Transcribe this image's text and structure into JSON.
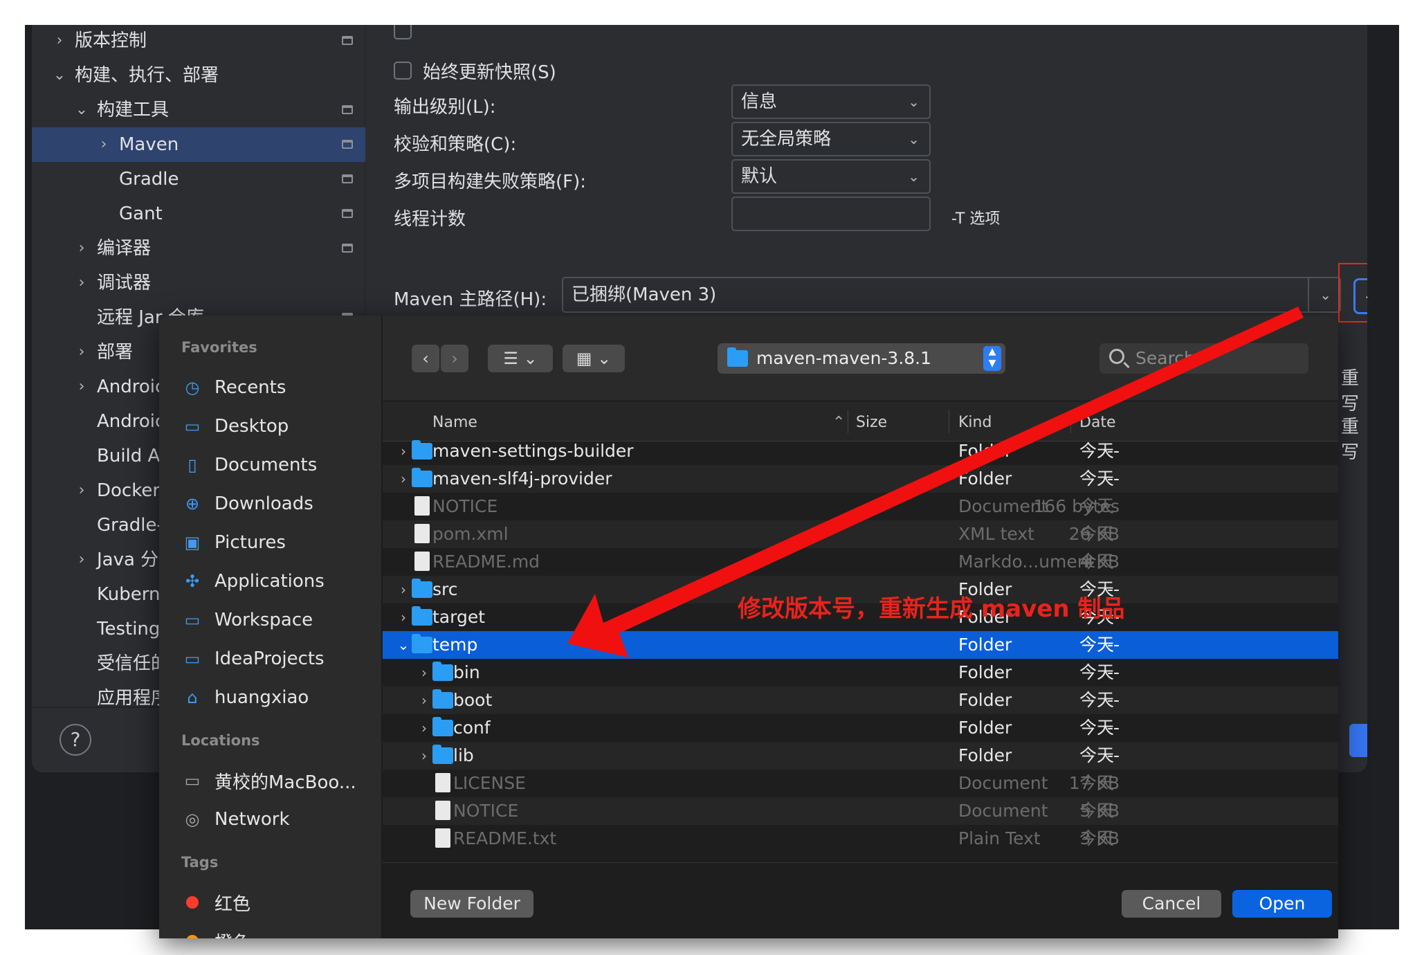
{
  "settings": {
    "tree": [
      {
        "label": "版本控制",
        "chevron": "›",
        "indent": 0,
        "page_icon": true,
        "selected": false
      },
      {
        "label": "构建、执行、部署",
        "chevron": "⌄",
        "indent": 0,
        "page_icon": false,
        "selected": false
      },
      {
        "label": "构建工具",
        "chevron": "⌄",
        "indent": 1,
        "page_icon": true,
        "selected": false
      },
      {
        "label": "Maven",
        "chevron": "›",
        "indent": 2,
        "page_icon": true,
        "selected": true
      },
      {
        "label": "Gradle",
        "chevron": "",
        "indent": 2,
        "page_icon": true,
        "selected": false
      },
      {
        "label": "Gant",
        "chevron": "",
        "indent": 2,
        "page_icon": true,
        "selected": false
      },
      {
        "label": "编译器",
        "chevron": "›",
        "indent": 1,
        "page_icon": true,
        "selected": false
      },
      {
        "label": "调试器",
        "chevron": "›",
        "indent": 1,
        "page_icon": false,
        "selected": false
      },
      {
        "label": "远程 Jar 仓库",
        "chevron": "",
        "indent": 1,
        "page_icon": true,
        "selected": false
      },
      {
        "label": "部署",
        "chevron": "›",
        "indent": 1,
        "page_icon": false,
        "selected": false
      },
      {
        "label": "Androic",
        "chevron": "›",
        "indent": 1,
        "page_icon": false,
        "selected": false
      },
      {
        "label": "Androic",
        "chevron": "",
        "indent": 1,
        "page_icon": false,
        "selected": false
      },
      {
        "label": "Build A",
        "chevron": "",
        "indent": 1,
        "page_icon": false,
        "selected": false
      },
      {
        "label": "Docker",
        "chevron": "›",
        "indent": 1,
        "page_icon": false,
        "selected": false
      },
      {
        "label": "Gradle-",
        "chevron": "",
        "indent": 1,
        "page_icon": false,
        "selected": false
      },
      {
        "label": "Java 分",
        "chevron": "›",
        "indent": 1,
        "page_icon": false,
        "selected": false
      },
      {
        "label": "Kubern",
        "chevron": "",
        "indent": 1,
        "page_icon": false,
        "selected": false
      },
      {
        "label": "Testing",
        "chevron": "",
        "indent": 1,
        "page_icon": false,
        "selected": false
      },
      {
        "label": "受信任的",
        "chevron": "",
        "indent": 1,
        "page_icon": false,
        "selected": false
      },
      {
        "label": "应用程序",
        "chevron": "",
        "indent": 1,
        "page_icon": false,
        "selected": false
      }
    ],
    "help_label": "?",
    "checkbox_always_update": "始终更新快照(S)",
    "output_level_label": "输出级别(L):",
    "output_level_value": "信息",
    "checksum_label": "校验和策略(C):",
    "checksum_value": "无全局策略",
    "multiproject_label": "多项目构建失败策略(F):",
    "multiproject_value": "默认",
    "threads_label": "线程计数",
    "threads_value": "",
    "threads_hint": "-T 选项",
    "maven_home_label": "Maven 主路径(H):",
    "maven_home_value": "已捆绑(Maven 3)",
    "browse_label": "...",
    "side_partial_1": "重写",
    "side_partial_2": "重写"
  },
  "dialog": {
    "sidebar": {
      "favorites_heading": "Favorites",
      "favorites": [
        {
          "label": "Recents",
          "icon": "clock-icon"
        },
        {
          "label": "Desktop",
          "icon": "desktop-icon"
        },
        {
          "label": "Documents",
          "icon": "document-icon"
        },
        {
          "label": "Downloads",
          "icon": "download-icon"
        },
        {
          "label": "Pictures",
          "icon": "pictures-icon"
        },
        {
          "label": "Applications",
          "icon": "applications-icon"
        },
        {
          "label": "Workspace",
          "icon": "folder-icon"
        },
        {
          "label": "IdeaProjects",
          "icon": "folder-icon"
        },
        {
          "label": "huangxiao",
          "icon": "home-icon"
        }
      ],
      "locations_heading": "Locations",
      "locations": [
        {
          "label": "黄校的MacBoo...",
          "icon": "laptop-icon"
        },
        {
          "label": "Network",
          "icon": "network-icon"
        }
      ],
      "tags_heading": "Tags",
      "tags": [
        {
          "label": "红色",
          "color": "#ff3b30"
        },
        {
          "label": "橙色",
          "color": "#ff9500"
        }
      ]
    },
    "toolbar": {
      "back": "‹",
      "forward": "›",
      "list_view": "☰ ⌄",
      "grid_view": "▦ ⌄",
      "path": "maven-maven-3.8.1",
      "search_placeholder": "Search"
    },
    "columns": {
      "name": "Name",
      "size": "Size",
      "kind": "Kind",
      "date": "Date"
    },
    "files": [
      {
        "name": "maven-settings-builder",
        "size": "--",
        "kind": "Folder",
        "date": "今天",
        "type": "folder",
        "level": 0,
        "expand": "›",
        "dim": false,
        "selected": false
      },
      {
        "name": "maven-slf4j-provider",
        "size": "--",
        "kind": "Folder",
        "date": "今天",
        "type": "folder",
        "level": 0,
        "expand": "›",
        "dim": false,
        "selected": false
      },
      {
        "name": "NOTICE",
        "size": "166 bytes",
        "kind": "Document",
        "date": "今天",
        "type": "doc",
        "level": 0,
        "expand": "",
        "dim": true,
        "selected": false
      },
      {
        "name": "pom.xml",
        "size": "26 KB",
        "kind": "XML text",
        "date": "今天",
        "type": "doc",
        "level": 0,
        "expand": "",
        "dim": true,
        "selected": false
      },
      {
        "name": "README.md",
        "size": "4 KB",
        "kind": "Markdo...ument",
        "date": "今天",
        "type": "doc",
        "level": 0,
        "expand": "",
        "dim": true,
        "selected": false
      },
      {
        "name": "src",
        "size": "--",
        "kind": "Folder",
        "date": "今天",
        "type": "folder",
        "level": 0,
        "expand": "›",
        "dim": false,
        "selected": false
      },
      {
        "name": "target",
        "size": "--",
        "kind": "Folder",
        "date": "今天",
        "type": "folder",
        "level": 0,
        "expand": "›",
        "dim": false,
        "selected": false
      },
      {
        "name": "temp",
        "size": "--",
        "kind": "Folder",
        "date": "今天",
        "type": "folder",
        "level": 0,
        "expand": "⌄",
        "dim": false,
        "selected": true
      },
      {
        "name": "bin",
        "size": "--",
        "kind": "Folder",
        "date": "今天",
        "type": "folder",
        "level": 1,
        "expand": "›",
        "dim": false,
        "selected": false
      },
      {
        "name": "boot",
        "size": "--",
        "kind": "Folder",
        "date": "今天",
        "type": "folder",
        "level": 1,
        "expand": "›",
        "dim": false,
        "selected": false
      },
      {
        "name": "conf",
        "size": "--",
        "kind": "Folder",
        "date": "今天",
        "type": "folder",
        "level": 1,
        "expand": "›",
        "dim": false,
        "selected": false
      },
      {
        "name": "lib",
        "size": "--",
        "kind": "Folder",
        "date": "今天",
        "type": "folder",
        "level": 1,
        "expand": "›",
        "dim": false,
        "selected": false
      },
      {
        "name": "LICENSE",
        "size": "17 KB",
        "kind": "Document",
        "date": "今天",
        "type": "doc",
        "level": 1,
        "expand": "",
        "dim": true,
        "selected": false
      },
      {
        "name": "NOTICE",
        "size": "5 KB",
        "kind": "Document",
        "date": "今天",
        "type": "doc",
        "level": 1,
        "expand": "",
        "dim": true,
        "selected": false
      },
      {
        "name": "README.txt",
        "size": "3 KB",
        "kind": "Plain Text",
        "date": "今天",
        "type": "doc",
        "level": 1,
        "expand": "",
        "dim": true,
        "selected": false
      }
    ],
    "new_folder_label": "New Folder",
    "cancel_label": "Cancel",
    "open_label": "Open"
  },
  "annotation": {
    "text": "修改版本号，重新生成 maven 制品",
    "color": "#e9231c"
  }
}
